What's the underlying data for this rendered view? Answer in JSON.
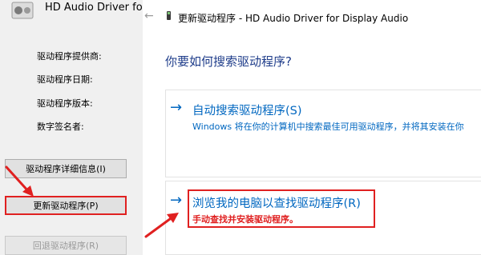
{
  "left_panel": {
    "device_name": "HD Audio Driver fo",
    "properties": [
      {
        "label": "驱动程序提供商:"
      },
      {
        "label": "驱动程序日期:"
      },
      {
        "label": "驱动程序版本:"
      },
      {
        "label": "数字签名者:"
      }
    ],
    "buttons": {
      "details": "驱动程序详细信息(I)",
      "update": "更新驱动程序(P)",
      "rollback": "回退驱动程序(R)"
    }
  },
  "dialog": {
    "back_glyph": "←",
    "title": "更新驱动程序 - HD Audio Driver for Display Audio",
    "question": "你要如何搜索驱动程序?",
    "options": [
      {
        "arrow": "→",
        "title": "自动搜索驱动程序(S)",
        "description": "Windows 将在你的计算机中搜索最佳可用驱动程序，并将其安装在你"
      },
      {
        "arrow": "→",
        "title": "浏览我的电脑以查找驱动程序(R)",
        "description": "手动查找并安装驱动程序。"
      }
    ]
  },
  "colors": {
    "link": "#0067c0",
    "annotation": "#e02020",
    "question": "#1e3c8a",
    "panel_bg": "#f0f0f0"
  },
  "icons": [
    "speaker-device-icon",
    "back-arrow-icon",
    "chip-icon",
    "annotation-arrow"
  ]
}
